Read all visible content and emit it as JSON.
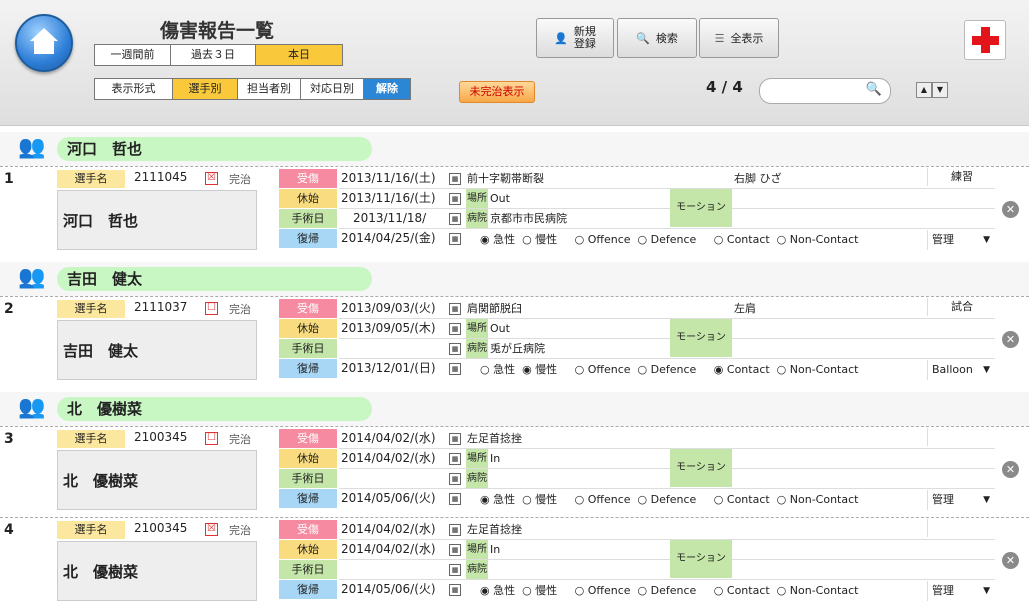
{
  "header": {
    "title": "傷害報告一覧",
    "period_tabs": [
      "一週間前",
      "過去３日",
      "本日"
    ],
    "view_tabs": [
      "表示形式",
      "選手別",
      "担当者別",
      "対応日別",
      "解除"
    ],
    "btn_new": "新規\n登録",
    "btn_search": "検索",
    "btn_all": "全表示",
    "btn_incomplete": "未完治表示",
    "pager": "4 / 4",
    "search_placeholder": ""
  },
  "groups": [
    {
      "name": "河口　哲也"
    },
    {
      "name": "吉田　健太"
    },
    {
      "name": "北　優樹菜"
    }
  ],
  "records": [
    {
      "index": "1",
      "player_label": "選手名",
      "player_id": "2111045",
      "checked": "☒",
      "kanchi": "完治",
      "name": "河口　哲也",
      "lbl_injury": "受傷",
      "lbl_rest": "休始",
      "lbl_surgery": "手術日",
      "lbl_return": "復帰",
      "injury_date": "2013/11/16/(土)",
      "rest_date": "2013/11/16/(土)",
      "surgery_date": "2013/11/18/",
      "return_date": "2014/04/25/(金)",
      "diagnosis": "前十字靭帯断裂",
      "part": "右脚 ひざ",
      "kind": "練習",
      "lbl_place": "場所",
      "place": "Out",
      "lbl_hospital": "病院",
      "hospital": "京都市市民病院",
      "lbl_motion": "モーション",
      "radios": "◉ 急性  ○ 慢性     ○ Offence  ○ Defence     ○ Contact  ○ Non-Contact",
      "manager": "管理"
    },
    {
      "index": "2",
      "player_label": "選手名",
      "player_id": "2111037",
      "checked": "☐",
      "kanchi": "完治",
      "name": "吉田　健太",
      "lbl_injury": "受傷",
      "lbl_rest": "休始",
      "lbl_surgery": "手術日",
      "lbl_return": "復帰",
      "injury_date": "2013/09/03/(火)",
      "rest_date": "2013/09/05/(木)",
      "surgery_date": "",
      "return_date": "2013/12/01/(日)",
      "diagnosis": "肩関節脱臼",
      "part": "左肩",
      "kind": "試合",
      "lbl_place": "場所",
      "place": "Out",
      "lbl_hospital": "病院",
      "hospital": "兎が丘病院",
      "lbl_motion": "モーション",
      "radios": "○ 急性  ◉ 慢性     ○ Offence  ○ Defence     ◉ Contact  ○ Non-Contact",
      "manager": "Balloon"
    },
    {
      "index": "3",
      "player_label": "選手名",
      "player_id": "2100345",
      "checked": "☐",
      "kanchi": "完治",
      "name": "北　優樹菜",
      "lbl_injury": "受傷",
      "lbl_rest": "休始",
      "lbl_surgery": "手術日",
      "lbl_return": "復帰",
      "injury_date": "2014/04/02/(水)",
      "rest_date": "2014/04/02/(水)",
      "surgery_date": "",
      "return_date": "2014/05/06/(火)",
      "diagnosis": "左足首捻挫",
      "part": "",
      "kind": "",
      "lbl_place": "場所",
      "place": "In",
      "lbl_hospital": "病院",
      "hospital": "",
      "lbl_motion": "モーション",
      "radios": "◉ 急性  ○ 慢性     ○ Offence  ○ Defence     ○ Contact  ○ Non-Contact",
      "manager": "管理"
    },
    {
      "index": "4",
      "player_label": "選手名",
      "player_id": "2100345",
      "checked": "☒",
      "kanchi": "完治",
      "name": "北　優樹菜",
      "lbl_injury": "受傷",
      "lbl_rest": "休始",
      "lbl_surgery": "手術日",
      "lbl_return": "復帰",
      "injury_date": "2014/04/02/(水)",
      "rest_date": "2014/04/02/(水)",
      "surgery_date": "",
      "return_date": "2014/05/06/(火)",
      "diagnosis": "左足首捻挫",
      "part": "",
      "kind": "",
      "lbl_place": "場所",
      "place": "In",
      "lbl_hospital": "病院",
      "hospital": "",
      "lbl_motion": "モーション",
      "radios": "◉ 急性  ○ 慢性     ○ Offence  ○ Defence     ○ Contact  ○ Non-Contact",
      "manager": "管理"
    }
  ]
}
